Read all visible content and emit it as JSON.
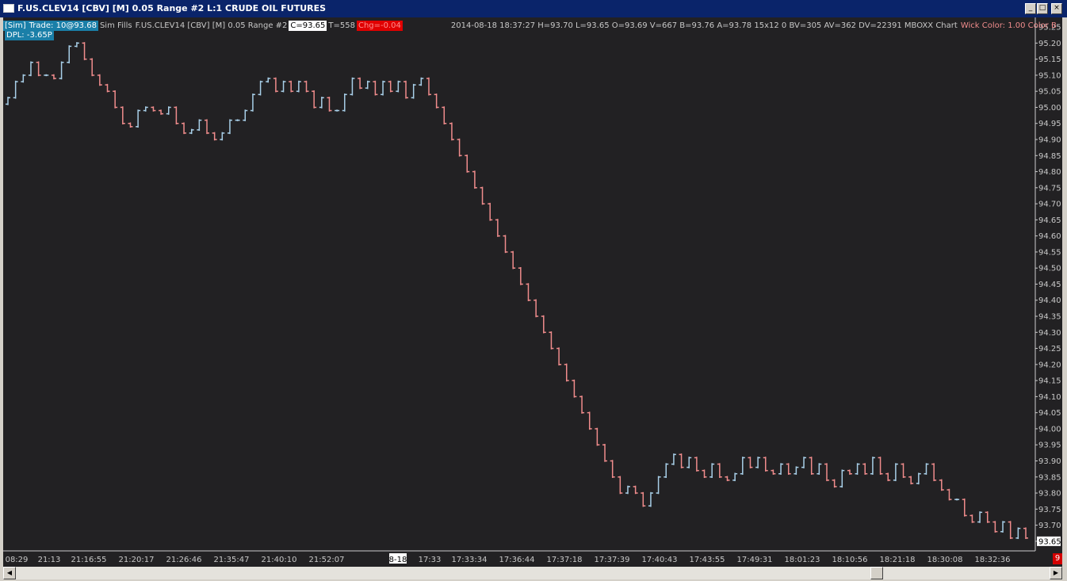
{
  "window": {
    "title": "F.US.CLEV14 [CBV] [M]  0.05 Range  #2  L:1  CRUDE OIL FUTURES",
    "minimize_glyph": "_",
    "maximize_glyph": "□",
    "close_glyph": "×"
  },
  "info_bar": {
    "account": "[Sim]",
    "trade": "Trade: 10@93.68",
    "fills": "Sim Fills",
    "symbol": "F.US.CLEV14 [CBV] [M]  0.05 Range  #2",
    "close": "C=93.65",
    "ticks": "T=558",
    "change": "Chg=-0.04",
    "hidden_box": "",
    "stats": "2014-08-18 18:37:27 H=93.70 L=93.65 O=93.69 V=667 B=93.76 A=93.78 15x12 0 BV=305 AV=362 DV=22391  MBOXX Chart",
    "wick": "Wick Color: 1.00  Color B"
  },
  "dpl": "DPL: -3.65P",
  "colors": {
    "background": "#222123",
    "up_bar": "#a8cfe8",
    "down_bar": "#f08c8c",
    "axis_text": "#c8c8c8",
    "change_bg": "#e00000",
    "dark_green": "#0e4a14"
  },
  "counter": "9",
  "chart_data": {
    "type": "range-bar",
    "y_ticks": [
      "95.25",
      "95.20",
      "95.15",
      "95.10",
      "95.05",
      "95.00",
      "94.95",
      "94.90",
      "94.85",
      "94.80",
      "94.75",
      "94.70",
      "94.65",
      "94.60",
      "94.55",
      "94.50",
      "94.45",
      "94.40",
      "94.35",
      "94.30",
      "94.25",
      "94.20",
      "94.15",
      "94.10",
      "94.05",
      "94.00",
      "93.95",
      "93.90",
      "93.85",
      "93.80",
      "93.75",
      "93.70",
      "93.65"
    ],
    "ylim": [
      93.625,
      95.265
    ],
    "current_price": "93.65",
    "x_ticks": [
      "08:29",
      "21:13",
      "21:16:55",
      "21:20:17",
      "21:26:46",
      "21:35:47",
      "21:40:10",
      "21:52:07",
      "8-18",
      "17:33",
      "17:33:34",
      "17:36:44",
      "17:37:18",
      "17:37:39",
      "17:40:43",
      "17:43:55",
      "17:49:31",
      "18:01:23",
      "18:10:56",
      "18:21:18",
      "18:30:08",
      "18:32:36"
    ],
    "x_tick_highlight": "8-18",
    "closes": [
      95.03,
      95.08,
      95.1,
      95.14,
      95.1,
      95.1,
      95.09,
      95.14,
      95.19,
      95.2,
      95.15,
      95.1,
      95.07,
      95.05,
      95.0,
      94.95,
      94.94,
      94.99,
      95.0,
      94.99,
      94.98,
      95.0,
      94.95,
      94.92,
      94.93,
      94.96,
      94.92,
      94.9,
      94.92,
      94.96,
      94.96,
      94.99,
      95.04,
      95.08,
      95.09,
      95.05,
      95.08,
      95.05,
      95.08,
      95.05,
      95.0,
      95.03,
      94.99,
      94.99,
      95.04,
      95.09,
      95.06,
      95.08,
      95.04,
      95.08,
      95.05,
      95.08,
      95.03,
      95.07,
      95.09,
      95.04,
      95.0,
      94.95,
      94.9,
      94.85,
      94.8,
      94.75,
      94.7,
      94.65,
      94.6,
      94.55,
      94.5,
      94.45,
      94.4,
      94.35,
      94.3,
      94.25,
      94.2,
      94.15,
      94.1,
      94.05,
      94.0,
      93.95,
      93.9,
      93.85,
      93.8,
      93.82,
      93.8,
      93.76,
      93.8,
      93.85,
      93.89,
      93.92,
      93.88,
      93.91,
      93.87,
      93.85,
      93.89,
      93.85,
      93.84,
      93.86,
      93.91,
      93.88,
      93.91,
      93.87,
      93.86,
      93.89,
      93.86,
      93.88,
      93.91,
      93.86,
      93.89,
      93.84,
      93.82,
      93.87,
      93.86,
      93.89,
      93.86,
      93.91,
      93.86,
      93.84,
      93.89,
      93.85,
      93.83,
      93.86,
      93.89,
      93.84,
      93.81,
      93.78,
      93.78,
      93.73,
      93.71,
      93.74,
      93.71,
      93.68,
      93.71,
      93.66,
      93.69,
      93.66
    ]
  }
}
